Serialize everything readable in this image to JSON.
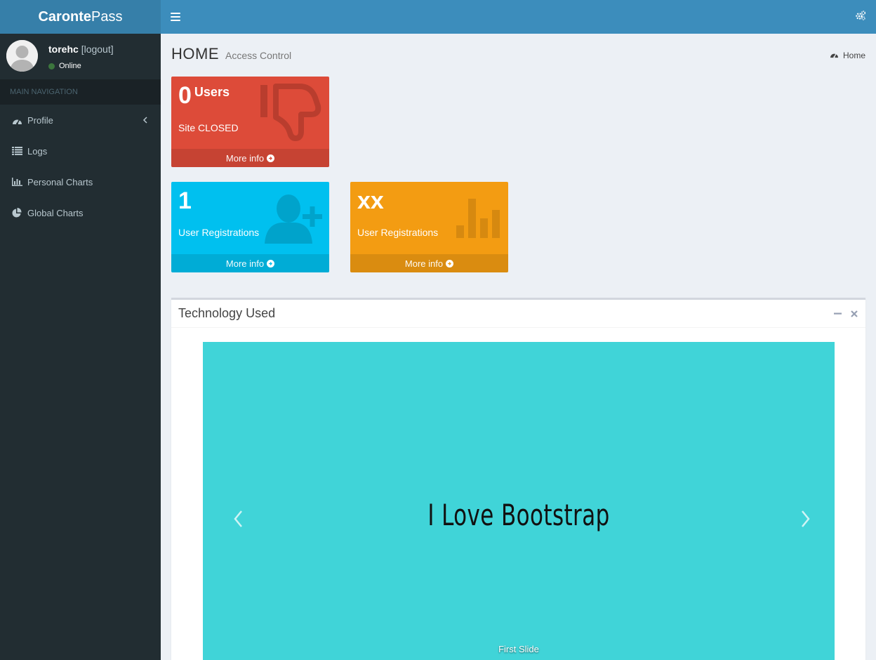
{
  "header": {
    "logo_bold": "Caronte",
    "logo_rest": "Pass"
  },
  "user": {
    "name": "torehc",
    "logout": "[logout]",
    "status": "Online"
  },
  "sidebar": {
    "header": "MAIN NAVIGATION",
    "items": [
      {
        "label": "Profile",
        "icon": "dashboard-icon"
      },
      {
        "label": "Logs",
        "icon": "list-icon"
      },
      {
        "label": "Personal Charts",
        "icon": "bar-chart-icon"
      },
      {
        "label": "Global Charts",
        "icon": "pie-chart-icon"
      }
    ]
  },
  "content": {
    "title": "HOME",
    "subtitle": "Access Control",
    "breadcrumb": "Home"
  },
  "boxes": {
    "users": {
      "number": "0",
      "number_label": "Users",
      "desc": "Site CLOSED",
      "more": "More info",
      "color": "#dd4b39"
    },
    "registrations": {
      "number": "1",
      "desc": "User Registrations",
      "more": "More info",
      "color": "#00c0ef"
    },
    "registrations_xx": {
      "number": "xx",
      "desc": "User Registrations",
      "more": "More info",
      "color": "#f39c12"
    }
  },
  "tech": {
    "title": "Technology Used",
    "slide_text": "I Love Bootstrap",
    "caption": "First Slide",
    "slide_bg": "#40d4d8"
  },
  "colors": {
    "header": "#3c8dbc",
    "logo_bg": "#367fa9",
    "sidebar": "#222d32"
  }
}
